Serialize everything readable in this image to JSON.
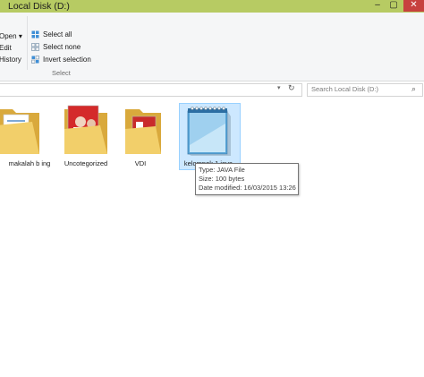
{
  "window": {
    "title": "Local Disk (D:)",
    "minimize": "–",
    "maximize": "▢",
    "close": "✕"
  },
  "ribbon": {
    "open_label": "Open",
    "open_arrow": "▾",
    "edit_label": "Edit",
    "history_label": "History",
    "select_all": "Select all",
    "select_none": "Select none",
    "invert_selection": "Invert selection",
    "group_select": "Select"
  },
  "address": {
    "dropdown": "▾",
    "refresh": "↻"
  },
  "search": {
    "placeholder": "Search Local Disk (D:)",
    "icon": "⌕"
  },
  "files": [
    {
      "name": "makalah b ing",
      "type": "folder-docs"
    },
    {
      "name": "Uncotegorized",
      "type": "folder-photos"
    },
    {
      "name": "VDI",
      "type": "folder-red"
    },
    {
      "name": "kelompok 1.java",
      "type": "notepad-file",
      "selected": true
    }
  ],
  "tooltip": {
    "type": "Type: JAVA File",
    "size": "Size: 100 bytes",
    "modified": "Date modified: 16/03/2015 13:26"
  },
  "colors": {
    "titlebar": "#b7cb63",
    "close_button": "#c7413f",
    "selection": "#cde8ff",
    "folder": "#e8c05a"
  }
}
